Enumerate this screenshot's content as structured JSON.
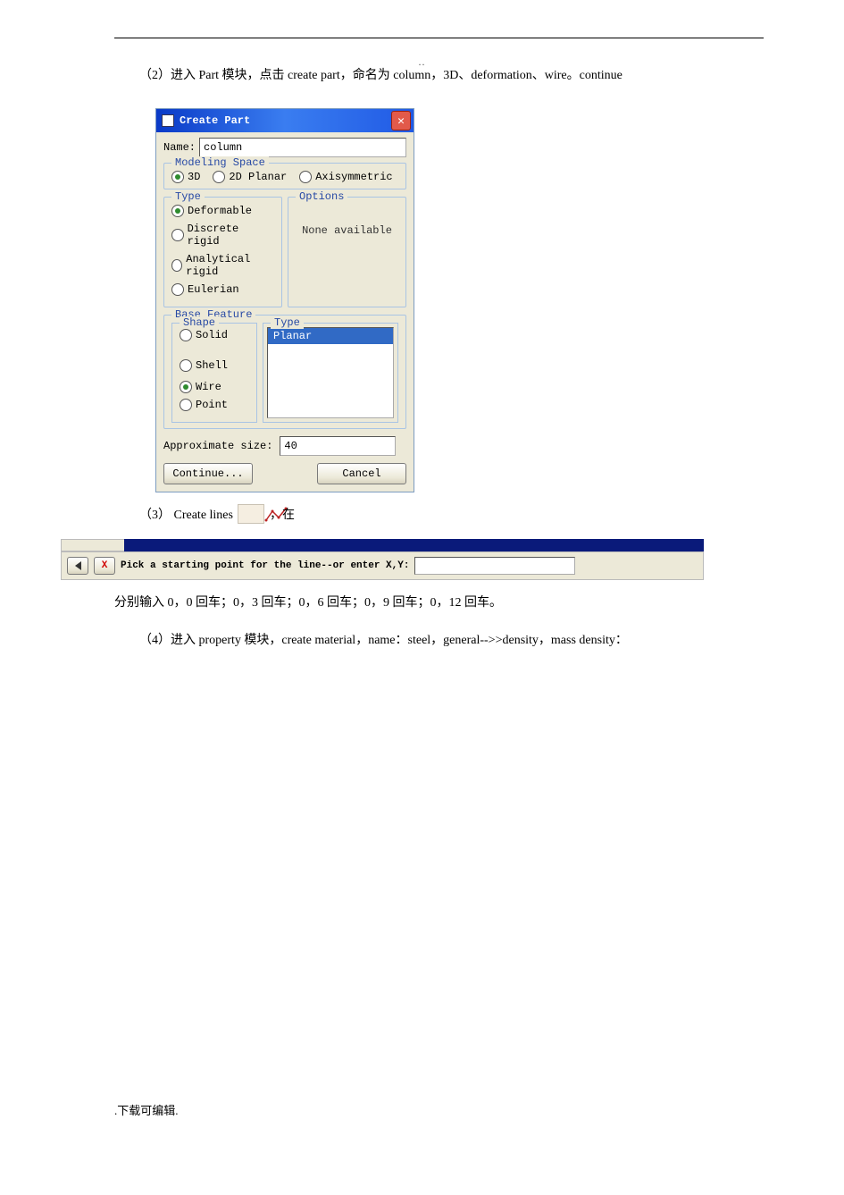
{
  "header": {
    "dots": ".."
  },
  "para1": "（2）进入 Part 模块，点击 create part，命名为 column，3D、deformation、wire。continue",
  "dialog": {
    "title": "Create Part",
    "name_label": "Name:",
    "name_value": "column",
    "modeling_space": {
      "legend": "Modeling Space",
      "opts": [
        "3D",
        "2D Planar",
        "Axisymmetric"
      ],
      "selected": "3D"
    },
    "type": {
      "legend": "Type",
      "opts": [
        "Deformable",
        "Discrete rigid",
        "Analytical rigid",
        "Eulerian"
      ],
      "selected": "Deformable"
    },
    "options": {
      "legend": "Options",
      "text": "None available"
    },
    "base_feature": {
      "legend": "Base Feature",
      "shape": {
        "legend": "Shape",
        "opts": [
          "Solid",
          "Shell",
          "Wire",
          "Point"
        ],
        "selected": "Wire"
      },
      "bftype": {
        "legend": "Type",
        "items": [
          "Planar"
        ],
        "selected": "Planar"
      }
    },
    "approx": {
      "label": "Approximate size:",
      "value": "40"
    },
    "buttons": {
      "continue": "Continue...",
      "cancel": "Cancel"
    }
  },
  "para3_before": "（3） Create lines ",
  "para3_after": "，在",
  "prompt": {
    "text": "Pick a starting point for the line--or enter X,Y:",
    "xy_value": ""
  },
  "para_inputs": "分别输入 0，0 回车；0，3 回车；0，6 回车；0，9 回车；0，12 回车。",
  "para4": "（4）进入 property 模块，create material，name：steel，general-->>density，mass density：",
  "footer": ".下载可编辑."
}
